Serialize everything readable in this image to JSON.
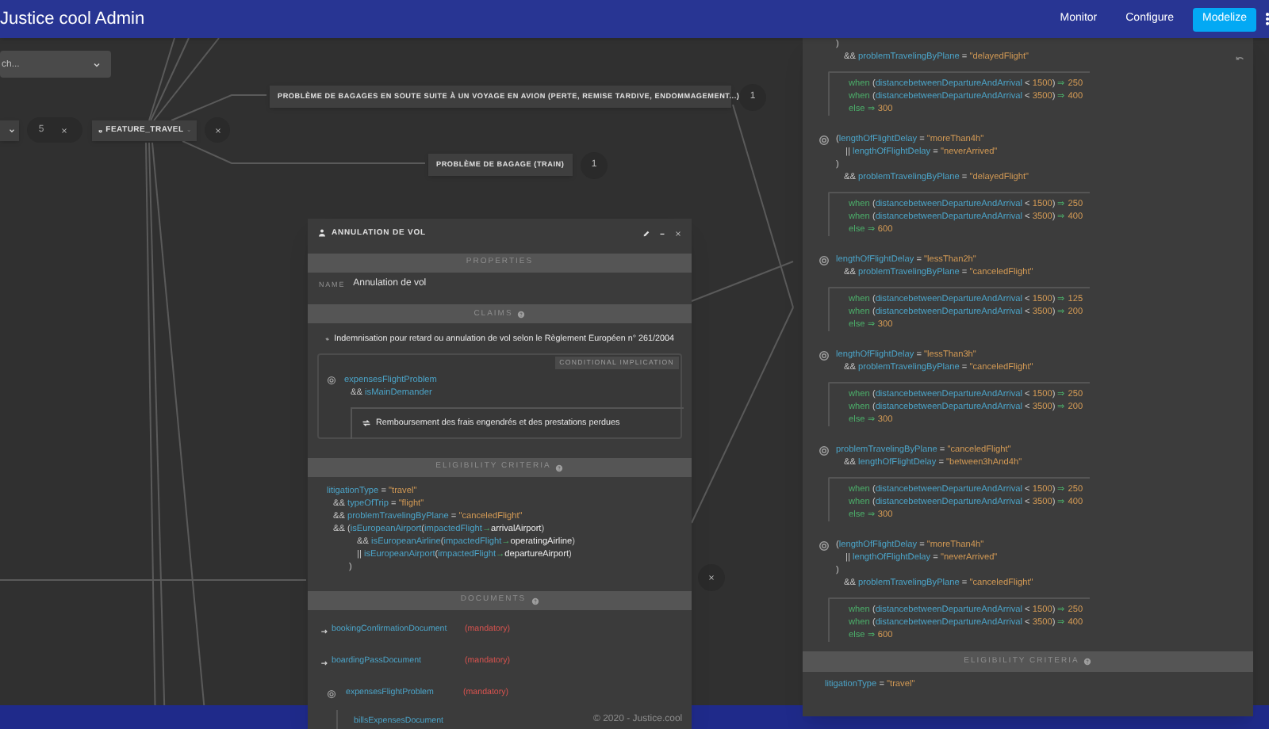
{
  "app_bar": {
    "title": "Justice cool Admin",
    "nav": [
      {
        "label": "Monitor",
        "selected": false
      },
      {
        "label": "Configure",
        "selected": false
      },
      {
        "label": "Modelize",
        "selected": true
      }
    ]
  },
  "canvas": {
    "search": {
      "placeholder": "ch..."
    },
    "counter": "5",
    "feature_node": {
      "label": "FEATURE_TRAVEL"
    },
    "child_nodes": [
      {
        "label": "PROBLÈME DE BAGAGES EN SOUTE SUITE À UN VOYAGE EN AVION (PERTE, REMISE TARDIVE, ENDOMMAGEMENT...)",
        "count": "1"
      },
      {
        "label": "PROBLÈME DE BAGAGE (TRAIN)",
        "count": "1"
      }
    ]
  },
  "claim_panel": {
    "title": "ANNULATION DE VOL",
    "properties_header": "PROPERTIES",
    "name_label": "NAME",
    "name_value": "Annulation de vol",
    "claims_header": "CLAIMS",
    "claim": "Indemnisation pour retard ou annulation de vol selon le Règlement Européen n° 261/2004",
    "implication": {
      "tag": "CONDITIONAL IMPLICATION",
      "condition_lines": [
        {
          "kind": "start",
          "tokens": [
            {
              "kind": "id",
              "text": "expensesFlightProblem"
            }
          ]
        },
        {
          "kind": "and",
          "tokens": [
            {
              "kind": "op",
              "text": "&& "
            },
            {
              "kind": "id",
              "text": "isMainDemander"
            }
          ]
        }
      ],
      "result": "Remboursement des frais engendrés et des prestations perdues"
    },
    "eligibility_header": "ELIGIBILITY CRITERIA",
    "eligibility_lines": [
      {
        "kind": "start",
        "tokens": [
          {
            "kind": "id",
            "text": "litigationType"
          },
          {
            "kind": "op",
            "text": " = "
          },
          {
            "kind": "str",
            "text": "\"travel\""
          }
        ]
      },
      {
        "kind": "and",
        "tokens": [
          {
            "kind": "op",
            "text": "&& "
          },
          {
            "kind": "id",
            "text": "typeOfTrip"
          },
          {
            "kind": "op",
            "text": " = "
          },
          {
            "kind": "str",
            "text": "\"flight\""
          }
        ]
      },
      {
        "kind": "and",
        "tokens": [
          {
            "kind": "op",
            "text": "&& "
          },
          {
            "kind": "id",
            "text": "problemTravelingByPlane"
          },
          {
            "kind": "op",
            "text": " = "
          },
          {
            "kind": "str",
            "text": "\"canceledFlight\""
          }
        ]
      },
      {
        "kind": "and",
        "tokens": [
          {
            "kind": "op",
            "text": "&& ("
          },
          {
            "kind": "id",
            "text": "isEuropeanAirport"
          },
          {
            "kind": "op",
            "text": "("
          },
          {
            "kind": "id",
            "text": "impactedFlight"
          },
          {
            "kind": "kw",
            "text": "→"
          },
          {
            "kind": "plain",
            "text": "arrivalAirport"
          },
          {
            "kind": "op",
            "text": ")"
          }
        ]
      },
      {
        "kind": "sub",
        "tokens": [
          {
            "kind": "op",
            "text": "&& "
          },
          {
            "kind": "id",
            "text": "isEuropeanAirline"
          },
          {
            "kind": "op",
            "text": "("
          },
          {
            "kind": "id",
            "text": "impactedFlight"
          },
          {
            "kind": "kw",
            "text": "→"
          },
          {
            "kind": "plain",
            "text": "operatingAirline"
          },
          {
            "kind": "op",
            "text": ")"
          }
        ]
      },
      {
        "kind": "sub",
        "tokens": [
          {
            "kind": "op",
            "text": "|| "
          },
          {
            "kind": "id",
            "text": "isEuropeanAirport"
          },
          {
            "kind": "op",
            "text": "("
          },
          {
            "kind": "id",
            "text": "impactedFlight"
          },
          {
            "kind": "kw",
            "text": "→"
          },
          {
            "kind": "plain",
            "text": "departureAirport"
          },
          {
            "kind": "op",
            "text": ")"
          }
        ]
      },
      {
        "kind": "close",
        "tokens": [
          {
            "kind": "op",
            "text": ")"
          }
        ]
      }
    ],
    "documents_header": "DOCUMENTS",
    "documents": [
      {
        "kind": "document",
        "name": "bookingConfirmationDocument",
        "requirement": "(mandatory)"
      },
      {
        "kind": "document",
        "name": "boardingPassDocument",
        "requirement": "(mandatory)"
      },
      {
        "kind": "condition",
        "name": "expensesFlightProblem",
        "requirement": "(mandatory)",
        "children": [
          {
            "name": "billsExpensesDocument"
          }
        ]
      }
    ]
  },
  "rules_panel": {
    "rules": [
      {
        "kind": "partial",
        "conditions": [
          {
            "kind": "start",
            "tokens": [
              {
                "kind": "op",
                "text": ")"
              }
            ]
          },
          {
            "kind": "and",
            "tokens": [
              {
                "kind": "op",
                "text": "&& "
              },
              {
                "kind": "id",
                "text": "problemTravelingByPlane"
              },
              {
                "kind": "op",
                "text": " = "
              },
              {
                "kind": "str",
                "text": "\"delayedFlight\""
              }
            ]
          }
        ],
        "outcomes": [
          {
            "tokens": [
              {
                "kind": "kw",
                "text": "when "
              },
              {
                "kind": "op",
                "text": "("
              },
              {
                "kind": "id",
                "text": "distancebetweenDepartureAndArrival"
              },
              {
                "kind": "op",
                "text": " < "
              },
              {
                "kind": "num",
                "text": "1500"
              },
              {
                "kind": "op",
                "text": ")"
              },
              {
                "kind": "kw",
                "text": " ⇒ "
              },
              {
                "kind": "num",
                "text": "250"
              }
            ]
          },
          {
            "tokens": [
              {
                "kind": "kw",
                "text": "when "
              },
              {
                "kind": "op",
                "text": "("
              },
              {
                "kind": "id",
                "text": "distancebetweenDepartureAndArrival"
              },
              {
                "kind": "op",
                "text": " < "
              },
              {
                "kind": "num",
                "text": "3500"
              },
              {
                "kind": "op",
                "text": ")"
              },
              {
                "kind": "kw",
                "text": " ⇒ "
              },
              {
                "kind": "num",
                "text": "400"
              }
            ]
          },
          {
            "tokens": [
              {
                "kind": "kw",
                "text": "else ⇒ "
              },
              {
                "kind": "num",
                "text": "300"
              }
            ]
          }
        ]
      },
      {
        "kind": "full",
        "conditions": [
          {
            "kind": "start",
            "tokens": [
              {
                "kind": "op",
                "text": "("
              },
              {
                "kind": "id",
                "text": "lengthOfFlightDelay"
              },
              {
                "kind": "op",
                "text": " = "
              },
              {
                "kind": "str",
                "text": "\"moreThan4h\""
              }
            ]
          },
          {
            "kind": "sub",
            "tokens": [
              {
                "kind": "op",
                "text": "|| "
              },
              {
                "kind": "id",
                "text": "lengthOfFlightDelay"
              },
              {
                "kind": "op",
                "text": " = "
              },
              {
                "kind": "str",
                "text": "\"neverArrived\""
              }
            ]
          },
          {
            "kind": "start",
            "tokens": [
              {
                "kind": "op",
                "text": ")"
              }
            ]
          },
          {
            "kind": "and",
            "tokens": [
              {
                "kind": "op",
                "text": "&& "
              },
              {
                "kind": "id",
                "text": "problemTravelingByPlane"
              },
              {
                "kind": "op",
                "text": " = "
              },
              {
                "kind": "str",
                "text": "\"delayedFlight\""
              }
            ]
          }
        ],
        "outcomes": [
          {
            "tokens": [
              {
                "kind": "kw",
                "text": "when "
              },
              {
                "kind": "op",
                "text": "("
              },
              {
                "kind": "id",
                "text": "distancebetweenDepartureAndArrival"
              },
              {
                "kind": "op",
                "text": " < "
              },
              {
                "kind": "num",
                "text": "1500"
              },
              {
                "kind": "op",
                "text": ")"
              },
              {
                "kind": "kw",
                "text": " ⇒ "
              },
              {
                "kind": "num",
                "text": "250"
              }
            ]
          },
          {
            "tokens": [
              {
                "kind": "kw",
                "text": "when "
              },
              {
                "kind": "op",
                "text": "("
              },
              {
                "kind": "id",
                "text": "distancebetweenDepartureAndArrival"
              },
              {
                "kind": "op",
                "text": " < "
              },
              {
                "kind": "num",
                "text": "3500"
              },
              {
                "kind": "op",
                "text": ")"
              },
              {
                "kind": "kw",
                "text": " ⇒ "
              },
              {
                "kind": "num",
                "text": "400"
              }
            ]
          },
          {
            "tokens": [
              {
                "kind": "kw",
                "text": "else ⇒ "
              },
              {
                "kind": "num",
                "text": "600"
              }
            ]
          }
        ]
      },
      {
        "kind": "full",
        "conditions": [
          {
            "kind": "start",
            "tokens": [
              {
                "kind": "id",
                "text": "lengthOfFlightDelay"
              },
              {
                "kind": "op",
                "text": " = "
              },
              {
                "kind": "str",
                "text": "\"lessThan2h\""
              }
            ]
          },
          {
            "kind": "and",
            "tokens": [
              {
                "kind": "op",
                "text": "&& "
              },
              {
                "kind": "id",
                "text": "problemTravelingByPlane"
              },
              {
                "kind": "op",
                "text": " = "
              },
              {
                "kind": "str",
                "text": "\"canceledFlight\""
              }
            ]
          }
        ],
        "outcomes": [
          {
            "tokens": [
              {
                "kind": "kw",
                "text": "when "
              },
              {
                "kind": "op",
                "text": "("
              },
              {
                "kind": "id",
                "text": "distancebetweenDepartureAndArrival"
              },
              {
                "kind": "op",
                "text": " < "
              },
              {
                "kind": "num",
                "text": "1500"
              },
              {
                "kind": "op",
                "text": ")"
              },
              {
                "kind": "kw",
                "text": " ⇒ "
              },
              {
                "kind": "num",
                "text": "125"
              }
            ]
          },
          {
            "tokens": [
              {
                "kind": "kw",
                "text": "when "
              },
              {
                "kind": "op",
                "text": "("
              },
              {
                "kind": "id",
                "text": "distancebetweenDepartureAndArrival"
              },
              {
                "kind": "op",
                "text": " < "
              },
              {
                "kind": "num",
                "text": "3500"
              },
              {
                "kind": "op",
                "text": ")"
              },
              {
                "kind": "kw",
                "text": " ⇒ "
              },
              {
                "kind": "num",
                "text": "200"
              }
            ]
          },
          {
            "tokens": [
              {
                "kind": "kw",
                "text": "else ⇒ "
              },
              {
                "kind": "num",
                "text": "300"
              }
            ]
          }
        ]
      },
      {
        "kind": "full",
        "conditions": [
          {
            "kind": "start",
            "tokens": [
              {
                "kind": "id",
                "text": "lengthOfFlightDelay"
              },
              {
                "kind": "op",
                "text": " = "
              },
              {
                "kind": "str",
                "text": "\"lessThan3h\""
              }
            ]
          },
          {
            "kind": "and",
            "tokens": [
              {
                "kind": "op",
                "text": "&& "
              },
              {
                "kind": "id",
                "text": "problemTravelingByPlane"
              },
              {
                "kind": "op",
                "text": " = "
              },
              {
                "kind": "str",
                "text": "\"canceledFlight\""
              }
            ]
          }
        ],
        "outcomes": [
          {
            "tokens": [
              {
                "kind": "kw",
                "text": "when "
              },
              {
                "kind": "op",
                "text": "("
              },
              {
                "kind": "id",
                "text": "distancebetweenDepartureAndArrival"
              },
              {
                "kind": "op",
                "text": " < "
              },
              {
                "kind": "num",
                "text": "1500"
              },
              {
                "kind": "op",
                "text": ")"
              },
              {
                "kind": "kw",
                "text": " ⇒ "
              },
              {
                "kind": "num",
                "text": "250"
              }
            ]
          },
          {
            "tokens": [
              {
                "kind": "kw",
                "text": "when "
              },
              {
                "kind": "op",
                "text": "("
              },
              {
                "kind": "id",
                "text": "distancebetweenDepartureAndArrival"
              },
              {
                "kind": "op",
                "text": " < "
              },
              {
                "kind": "num",
                "text": "3500"
              },
              {
                "kind": "op",
                "text": ")"
              },
              {
                "kind": "kw",
                "text": " ⇒ "
              },
              {
                "kind": "num",
                "text": "200"
              }
            ]
          },
          {
            "tokens": [
              {
                "kind": "kw",
                "text": "else ⇒ "
              },
              {
                "kind": "num",
                "text": "300"
              }
            ]
          }
        ]
      },
      {
        "kind": "full",
        "conditions": [
          {
            "kind": "start",
            "tokens": [
              {
                "kind": "id",
                "text": "problemTravelingByPlane"
              },
              {
                "kind": "op",
                "text": " = "
              },
              {
                "kind": "str",
                "text": "\"canceledFlight\""
              }
            ]
          },
          {
            "kind": "and",
            "tokens": [
              {
                "kind": "op",
                "text": "&& "
              },
              {
                "kind": "id",
                "text": "lengthOfFlightDelay"
              },
              {
                "kind": "op",
                "text": " = "
              },
              {
                "kind": "str",
                "text": "\"between3hAnd4h\""
              }
            ]
          }
        ],
        "outcomes": [
          {
            "tokens": [
              {
                "kind": "kw",
                "text": "when "
              },
              {
                "kind": "op",
                "text": "("
              },
              {
                "kind": "id",
                "text": "distancebetweenDepartureAndArrival"
              },
              {
                "kind": "op",
                "text": " < "
              },
              {
                "kind": "num",
                "text": "1500"
              },
              {
                "kind": "op",
                "text": ")"
              },
              {
                "kind": "kw",
                "text": " ⇒ "
              },
              {
                "kind": "num",
                "text": "250"
              }
            ]
          },
          {
            "tokens": [
              {
                "kind": "kw",
                "text": "when "
              },
              {
                "kind": "op",
                "text": "("
              },
              {
                "kind": "id",
                "text": "distancebetweenDepartureAndArrival"
              },
              {
                "kind": "op",
                "text": " < "
              },
              {
                "kind": "num",
                "text": "3500"
              },
              {
                "kind": "op",
                "text": ")"
              },
              {
                "kind": "kw",
                "text": " ⇒ "
              },
              {
                "kind": "num",
                "text": "400"
              }
            ]
          },
          {
            "tokens": [
              {
                "kind": "kw",
                "text": "else ⇒ "
              },
              {
                "kind": "num",
                "text": "300"
              }
            ]
          }
        ]
      },
      {
        "kind": "full",
        "conditions": [
          {
            "kind": "start",
            "tokens": [
              {
                "kind": "op",
                "text": "("
              },
              {
                "kind": "id",
                "text": "lengthOfFlightDelay"
              },
              {
                "kind": "op",
                "text": " = "
              },
              {
                "kind": "str",
                "text": "\"moreThan4h\""
              }
            ]
          },
          {
            "kind": "sub",
            "tokens": [
              {
                "kind": "op",
                "text": "|| "
              },
              {
                "kind": "id",
                "text": "lengthOfFlightDelay"
              },
              {
                "kind": "op",
                "text": " = "
              },
              {
                "kind": "str",
                "text": "\"neverArrived\""
              }
            ]
          },
          {
            "kind": "start",
            "tokens": [
              {
                "kind": "op",
                "text": ")"
              }
            ]
          },
          {
            "kind": "and",
            "tokens": [
              {
                "kind": "op",
                "text": "&& "
              },
              {
                "kind": "id",
                "text": "problemTravelingByPlane"
              },
              {
                "kind": "op",
                "text": " = "
              },
              {
                "kind": "str",
                "text": "\"canceledFlight\""
              }
            ]
          }
        ],
        "outcomes": [
          {
            "tokens": [
              {
                "kind": "kw",
                "text": "when "
              },
              {
                "kind": "op",
                "text": "("
              },
              {
                "kind": "id",
                "text": "distancebetweenDepartureAndArrival"
              },
              {
                "kind": "op",
                "text": " < "
              },
              {
                "kind": "num",
                "text": "1500"
              },
              {
                "kind": "op",
                "text": ")"
              },
              {
                "kind": "kw",
                "text": " ⇒ "
              },
              {
                "kind": "num",
                "text": "250"
              }
            ]
          },
          {
            "tokens": [
              {
                "kind": "kw",
                "text": "when "
              },
              {
                "kind": "op",
                "text": "("
              },
              {
                "kind": "id",
                "text": "distancebetweenDepartureAndArrival"
              },
              {
                "kind": "op",
                "text": " < "
              },
              {
                "kind": "num",
                "text": "3500"
              },
              {
                "kind": "op",
                "text": ")"
              },
              {
                "kind": "kw",
                "text": " ⇒ "
              },
              {
                "kind": "num",
                "text": "400"
              }
            ]
          },
          {
            "tokens": [
              {
                "kind": "kw",
                "text": "else ⇒ "
              },
              {
                "kind": "num",
                "text": "600"
              }
            ]
          }
        ]
      }
    ],
    "eligibility_header": "ELIGIBILITY CRITERIA",
    "eligibility_lines": [
      {
        "tokens": [
          {
            "kind": "id",
            "text": "litigationType"
          },
          {
            "kind": "op",
            "text": " = "
          },
          {
            "kind": "str",
            "text": "\"travel\""
          }
        ]
      }
    ]
  },
  "footer": {
    "copyright": "© 2020 - Justice.cool"
  }
}
